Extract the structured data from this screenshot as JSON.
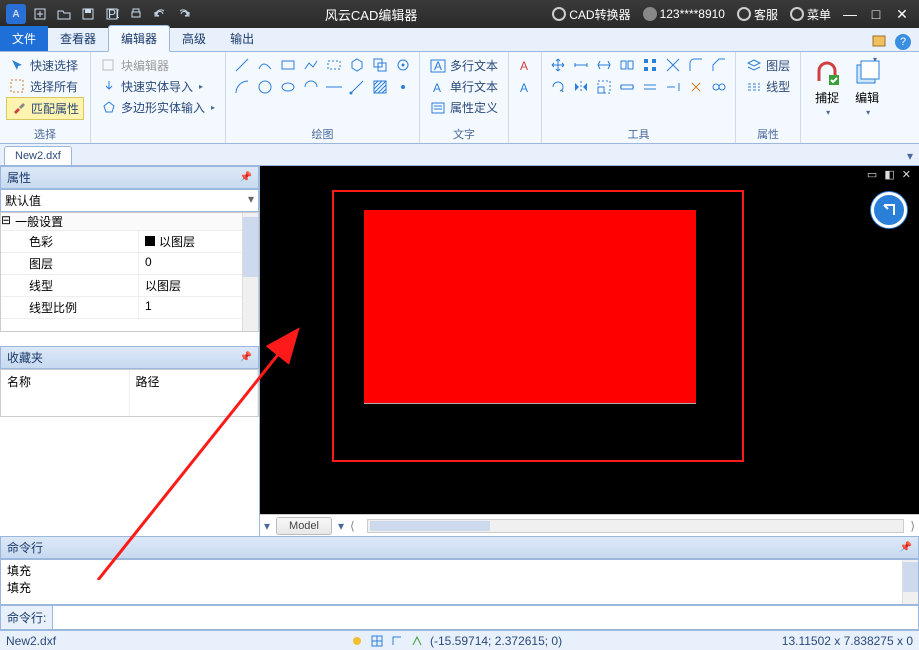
{
  "titlebar": {
    "app_title": "风云CAD编辑器",
    "converter": "CAD转换器",
    "user": "123****8910",
    "support": "客服",
    "menu": "菜单"
  },
  "menu": {
    "file": "文件",
    "viewer": "查看器",
    "editor": "编辑器",
    "advanced": "高级",
    "output": "输出"
  },
  "ribbon": {
    "select_group": "选择",
    "quick_select": "快速选择",
    "select_all": "选择所有",
    "match_props": "匹配属性",
    "block_editor": "块编辑器",
    "quick_solid_import": "快速实体导入",
    "poly_solid_input": "多边形实体输入",
    "draw_group": "绘图",
    "text_group": "文字",
    "mtext": "多行文本",
    "stext": "单行文本",
    "attrdef": "属性定义",
    "tools_group": "工具",
    "props_group": "属性",
    "layer": "图层",
    "ltype": "线型",
    "snap": "捕捉",
    "edit": "编辑"
  },
  "doc": {
    "tab": "New2.dxf"
  },
  "props": {
    "title": "属性",
    "default": "默认值",
    "cat_general": "一般设置",
    "k_color": "色彩",
    "v_color": "以图层",
    "k_layer": "图层",
    "v_layer": "0",
    "k_ltype": "线型",
    "v_ltype": "以图层",
    "k_lscale": "线型比例",
    "v_lscale": "1"
  },
  "fav": {
    "title": "收藏夹",
    "col_name": "名称",
    "col_path": "路径"
  },
  "model": {
    "tab": "Model"
  },
  "cmd": {
    "title": "命令行",
    "line1": "填充",
    "line2": "填充",
    "prompt": "命令行:"
  },
  "status": {
    "file": "New2.dxf",
    "coords": "(-15.59714; 2.372615; 0)",
    "right": "13.11502 x 7.838275 x 0"
  }
}
